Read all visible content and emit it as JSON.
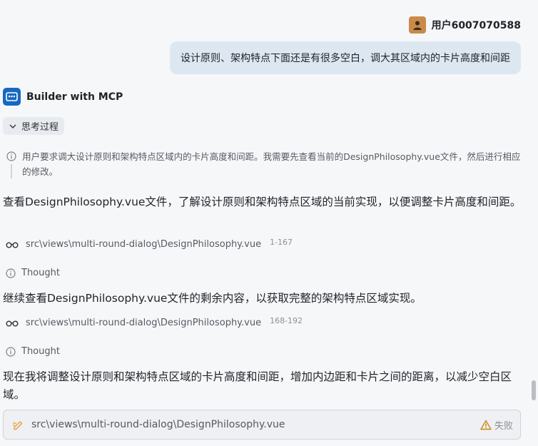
{
  "user": {
    "name": "用户6007070588",
    "message": "设计原则、架构特点下面还是有很多空白，调大其区域内的卡片高度和间距"
  },
  "assistant": {
    "name": "Builder with MCP",
    "think_toggle_label": "思考过程",
    "think_text": "用户要求调大设计原则和架构特点区域内的卡片高度和间距。我需要先查看当前的DesignPhilosophy.vue文件，然后进行相应的修改。",
    "para1": "查看DesignPhilosophy.vue文件，了解设计原则和架构特点区域的当前实现，以便调整卡片高度和间距。",
    "file_ref1": {
      "path": "src\\views\\multi-round-dialog\\DesignPhilosophy.vue",
      "range": "1-167"
    },
    "thought1": "Thought",
    "para2": "继续查看DesignPhilosophy.vue文件的剩余内容，以获取完整的架构特点区域实现。",
    "file_ref2": {
      "path": "src\\views\\multi-round-dialog\\DesignPhilosophy.vue",
      "range": "168-192"
    },
    "thought2": "Thought",
    "para3": "现在我将调整设计原则和架构特点区域的卡片高度和间距，增加内边距和卡片之间的距离，以减少空白区域。",
    "edit_card": {
      "path": "src\\views\\multi-round-dialog\\DesignPhilosophy.vue",
      "status": "失败"
    }
  },
  "colors": {
    "user_bubble": "#dde7f1",
    "bot_avatar": "#1769c2",
    "warning": "#c98a14",
    "edit_icon": "#e6a23c"
  }
}
